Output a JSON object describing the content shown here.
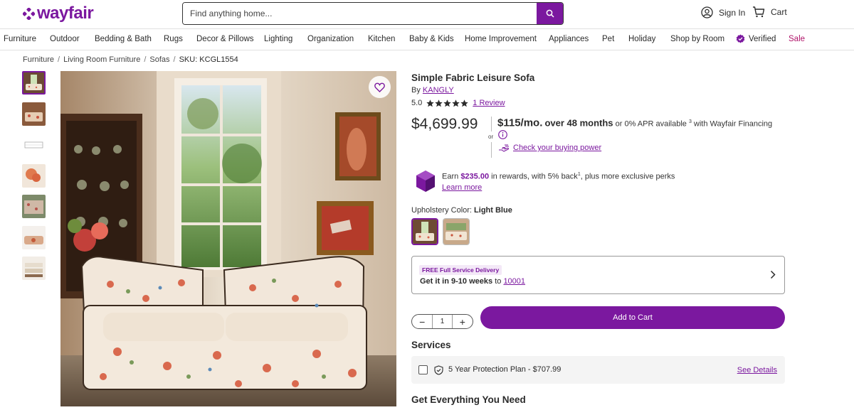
{
  "brand": {
    "name": "wayfair",
    "color": "#7b189f"
  },
  "search": {
    "placeholder": "Find anything home..."
  },
  "account": {
    "signin": "Sign In",
    "cart": "Cart"
  },
  "nav": [
    {
      "label": "Furniture"
    },
    {
      "label": "Outdoor"
    },
    {
      "label": "Bedding & Bath"
    },
    {
      "label": "Rugs"
    },
    {
      "label": "Decor & Pillows"
    },
    {
      "label": "Lighting"
    },
    {
      "label": "Organization"
    },
    {
      "label": "Kitchen"
    },
    {
      "label": "Baby & Kids"
    },
    {
      "label": "Home Improvement"
    },
    {
      "label": "Appliances"
    },
    {
      "label": "Pet"
    },
    {
      "label": "Holiday"
    },
    {
      "label": "Shop by Room"
    },
    {
      "label": "Verified"
    },
    {
      "label": "Sale"
    }
  ],
  "breadcrumb": {
    "items": [
      "Furniture",
      "Living Room Furniture",
      "Sofas"
    ],
    "separator": "/",
    "sku": "SKU: KCGL1554"
  },
  "product": {
    "title": "Simple Fabric Leisure Sofa",
    "by_prefix": "By",
    "brand": "KANGLY",
    "rating": "5.0",
    "stars": 5,
    "reviews": "1 Review",
    "price": "$4,699.99",
    "or": "or",
    "monthly_amount": "$115/mo.",
    "monthly_term": "over 48 months",
    "apr_text": "or 0% APR available",
    "apr_footnote": "3",
    "financing_text": "with Wayfair Financing",
    "buying_power": "Check your buying power"
  },
  "rewards": {
    "earn": "Earn",
    "amount": "$235.00",
    "text_mid": "in rewards, with 5% back",
    "footnote": "1",
    "text_end": ", plus more exclusive perks",
    "learn_more": "Learn more"
  },
  "upholstery": {
    "label": "Upholstery Color:",
    "value": "Light Blue"
  },
  "delivery": {
    "tag": "FREE Full Service Delivery",
    "prefix": "Get it in",
    "weeks": "9-10 weeks",
    "to": "to",
    "zip": "10001"
  },
  "cart": {
    "quantity": "1",
    "minus": "−",
    "plus": "+",
    "add_label": "Add to Cart"
  },
  "services": {
    "title": "Services",
    "protection": "5 Year Protection Plan - $707.99",
    "see_details": "See Details"
  },
  "everything_title": "Get Everything You Need"
}
